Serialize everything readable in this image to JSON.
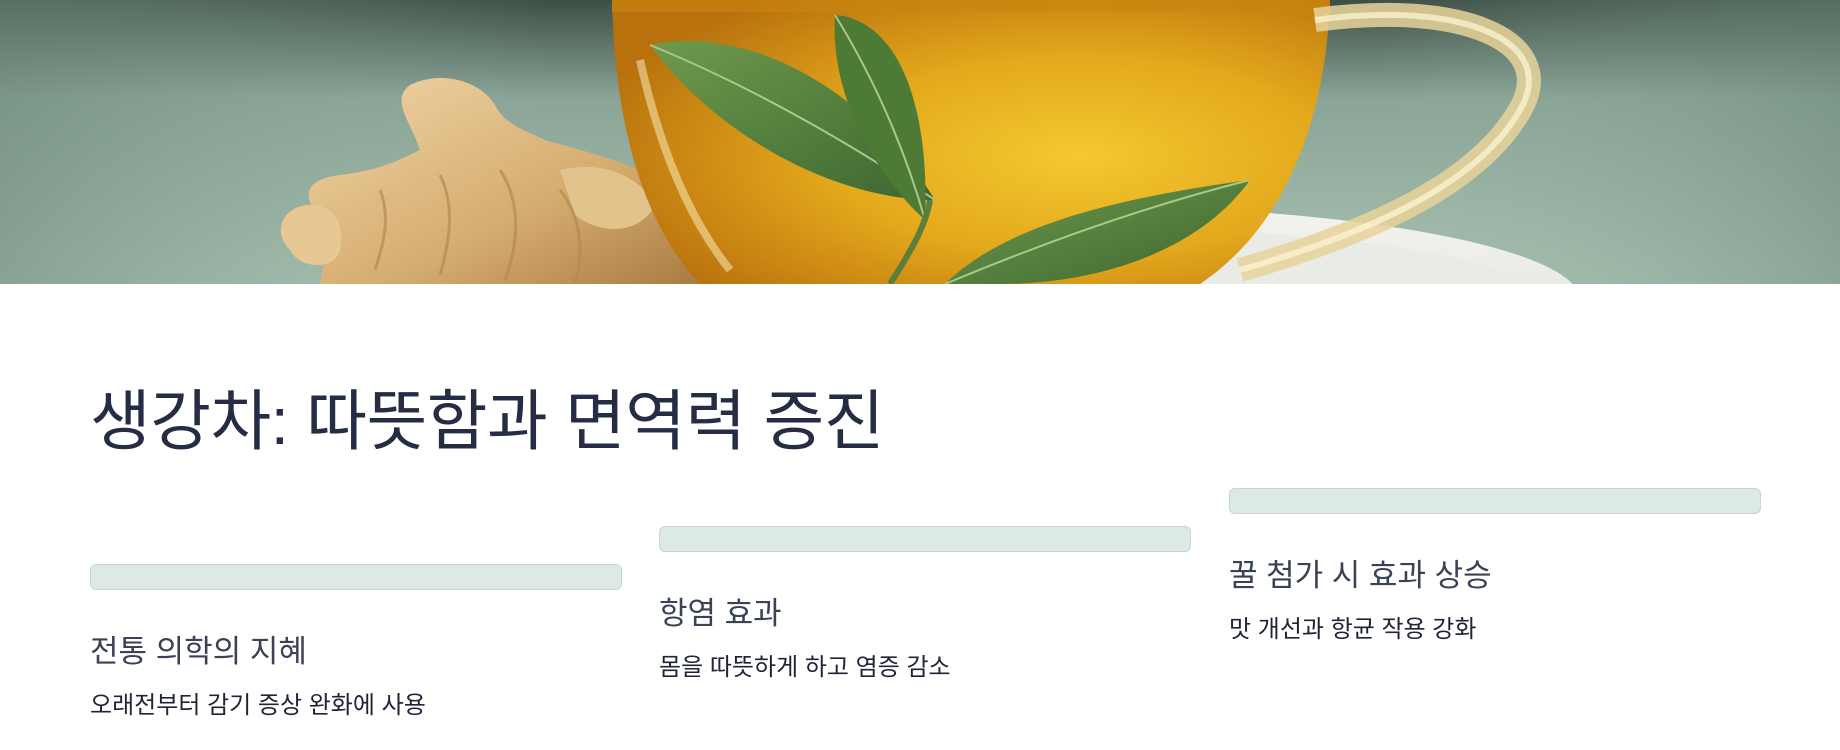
{
  "hero": {
    "image_description": "ginger-tea-cup-with-leaves-and-ginger-root"
  },
  "title": "생강차: 따뜻함과 면역력 증진",
  "cards": [
    {
      "title": "전통 의학의 지혜",
      "description": "오래전부터 감기 증상 완화에 사용"
    },
    {
      "title": "항염 효과",
      "description": "몸을 따뜻하게 하고 염증 감소"
    },
    {
      "title": "꿀 첨가 시 효과 상승",
      "description": "맛 개선과 항균 작용 강화"
    }
  ],
  "colors": {
    "title_text": "#252d44",
    "card_title_text": "#3a4256",
    "card_desc_text": "#1f2536",
    "bar_fill": "#dde9e5",
    "bar_border": "#c7d6d1",
    "hero_background": "#9fb8a6",
    "tea_amber": "#e0a21a",
    "leaf_green": "#4f7a3a",
    "ginger_tan": "#d9b27a"
  }
}
